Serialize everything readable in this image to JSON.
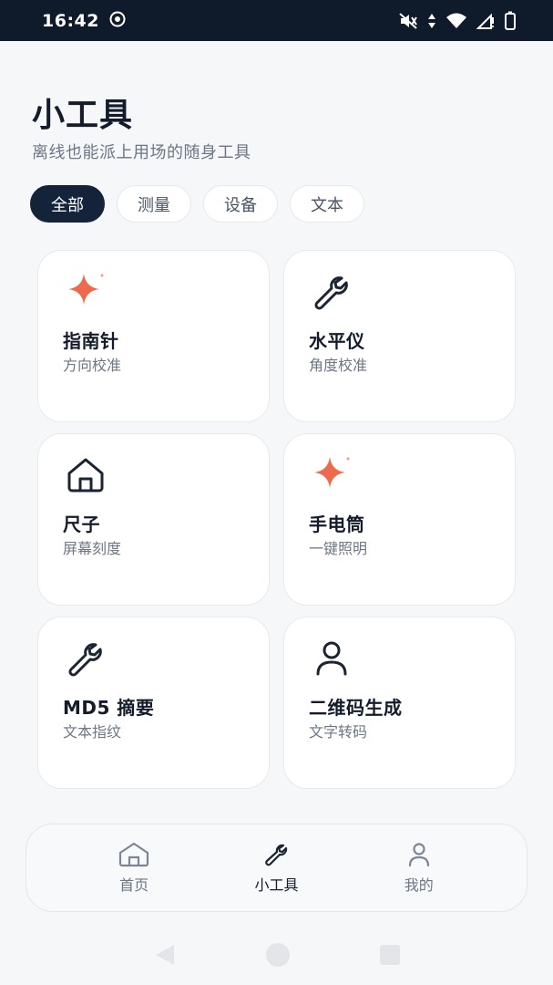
{
  "status_bar": {
    "time": "16:42"
  },
  "header": {
    "title": "小工具",
    "subtitle": "离线也能派上用场的随身工具"
  },
  "filters": [
    {
      "label": "全部",
      "active": true
    },
    {
      "label": "测量",
      "active": false
    },
    {
      "label": "设备",
      "active": false
    },
    {
      "label": "文本",
      "active": false
    }
  ],
  "tools": [
    {
      "title": "指南针",
      "subtitle": "方向校准",
      "icon": "sparkle-icon"
    },
    {
      "title": "水平仪",
      "subtitle": "角度校准",
      "icon": "wrench-icon"
    },
    {
      "title": "尺子",
      "subtitle": "屏幕刻度",
      "icon": "home-icon"
    },
    {
      "title": "手电筒",
      "subtitle": "一键照明",
      "icon": "sparkle-icon"
    },
    {
      "title": "MD5 摘要",
      "subtitle": "文本指纹",
      "icon": "wrench-icon"
    },
    {
      "title": "二维码生成",
      "subtitle": "文字转码",
      "icon": "person-icon"
    }
  ],
  "bottom_nav": [
    {
      "label": "首页",
      "icon": "home-icon",
      "active": false
    },
    {
      "label": "小工具",
      "icon": "wrench-icon",
      "active": true
    },
    {
      "label": "我的",
      "icon": "person-icon",
      "active": false
    }
  ],
  "colors": {
    "accent": "#ee6a4d",
    "dark": "#14233a",
    "background": "#f6f7f9",
    "muted": "#6c7686"
  }
}
